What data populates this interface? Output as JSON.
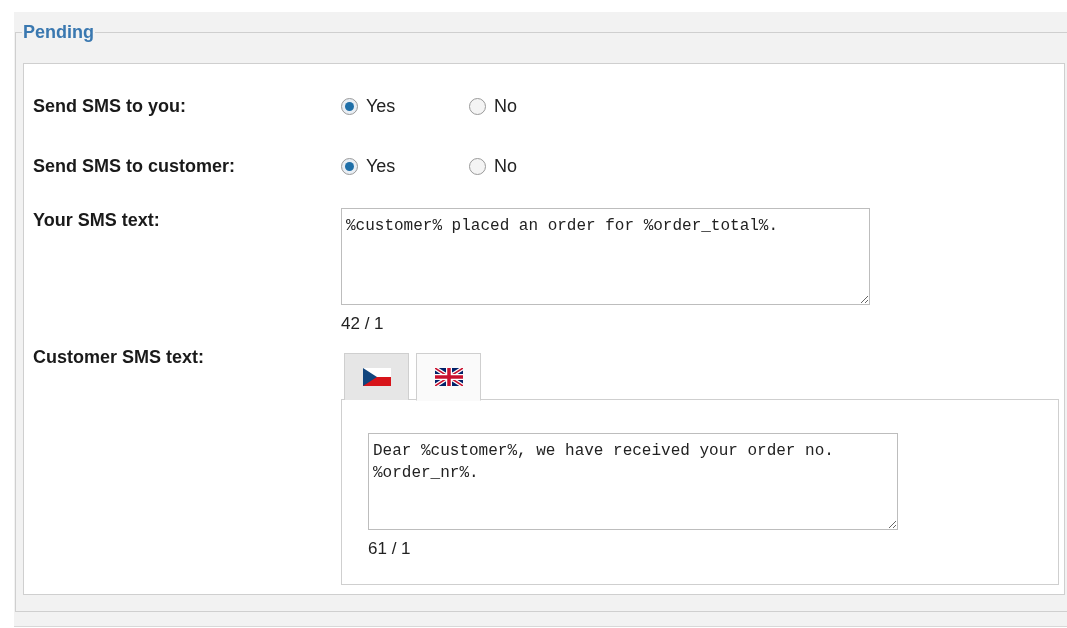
{
  "fieldset": {
    "legend": "Pending"
  },
  "rows": [
    {
      "kind": "radio",
      "label": "Send SMS to you:",
      "options": [
        {
          "label": "Yes",
          "selected": true
        },
        {
          "label": "No",
          "selected": false
        }
      ]
    },
    {
      "kind": "radio",
      "label": "Send SMS to customer:",
      "options": [
        {
          "label": "Yes",
          "selected": true
        },
        {
          "label": "No",
          "selected": false
        }
      ]
    },
    {
      "kind": "textarea",
      "label": "Your SMS text:",
      "value": "%customer% placed an order for %order_total%.",
      "counter": "42 / 1"
    },
    {
      "kind": "tabbed_textarea",
      "label": "Customer SMS text:",
      "tabs": [
        {
          "kind": "czech_flag",
          "selected": false
        },
        {
          "kind": "uk_flag",
          "selected": true
        }
      ],
      "value": "Dear %customer%, we have received your order no. %order_nr%.",
      "counter": "61 / 1"
    }
  ]
}
